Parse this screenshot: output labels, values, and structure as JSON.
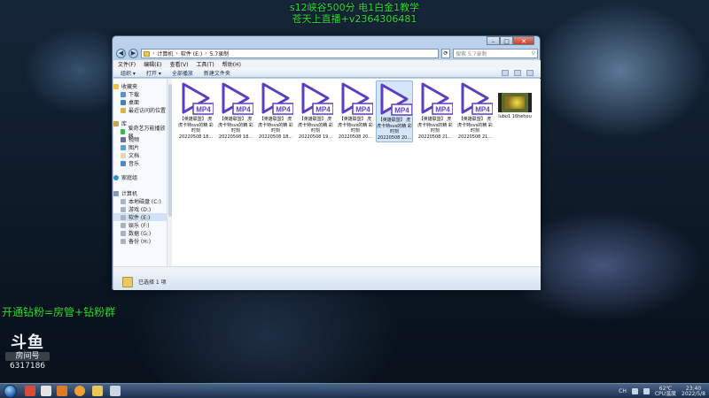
{
  "overlay": {
    "top_line1": "s12峡谷500分 电1白金1教学",
    "top_line2": "苍天上直播+v2364306481",
    "left_text": "开通钻粉=房管+钻粉群"
  },
  "douyu": {
    "logo": "斗鱼",
    "room_label": "房间号",
    "room_number": "6317186"
  },
  "window": {
    "controls": {
      "minimize": "–",
      "maximize": "□",
      "close": "✕"
    },
    "address": {
      "crumbs": [
        "计算机",
        "软件 (E:)",
        "5.7录制"
      ],
      "separator": "›"
    },
    "search_placeholder": "搜索 5.7录制",
    "search_icon": "magnifier-icon",
    "menu": [
      "文件(F)",
      "编辑(E)",
      "查看(V)",
      "工具(T)",
      "帮助(H)"
    ],
    "toolbar": [
      "组织 ▾",
      "打开 ▾",
      "全部播放",
      "新建文件夹"
    ],
    "nav": {
      "favorites_title": "收藏夹",
      "favorites": [
        "下载",
        "桌面",
        "最近访问的位置"
      ],
      "libraries_title": "库",
      "libraries": [
        "爱奇艺万能播放器",
        "视频",
        "图片",
        "文档",
        "音乐"
      ],
      "homegroup": "家庭组",
      "computer_title": "计算机",
      "drives": [
        "本地磁盘 (C:)",
        "游戏 (D:)",
        "软件 (E:)",
        "娱乐 (F:)",
        "数据 (G:)",
        "备份 (H:)"
      ]
    },
    "files": [
      {
        "badge": "MP4",
        "name": "【英雄联盟】 虎 虎卡特svs的精 彩时刻",
        "date": "20220508 18..."
      },
      {
        "badge": "MP4",
        "name": "【英雄联盟】 虎 虎卡特svs的精 彩时刻",
        "date": "20220508 18..."
      },
      {
        "badge": "MP4",
        "name": "【英雄联盟】 虎 虎卡特svs的精 彩时刻",
        "date": "20220508 18..."
      },
      {
        "badge": "MP4",
        "name": "【英雄联盟】 虎 虎卡特svs的精 彩时刻",
        "date": "20220508 19..."
      },
      {
        "badge": "MP4",
        "name": "【英雄联盟】 虎 虎卡特svs的精 彩时刻",
        "date": "20220508 20..."
      },
      {
        "badge": "MP4",
        "name": "【英雄联盟】 虎 虎卡特svs的精 彩时刻",
        "date": "20220508 20..."
      },
      {
        "badge": "MP4",
        "name": "【英雄联盟】 虎 虎卡特svs的精 彩时刻",
        "date": "20220508 21..."
      },
      {
        "badge": "MP4",
        "name": "【英雄联盟】 虎 虎卡特svs的精 彩时刻",
        "date": "20220508 21..."
      }
    ],
    "video_file": {
      "name": "lubo1 16hehou"
    },
    "status": "已选择 1 项"
  },
  "taskbar": {
    "lang": "CH",
    "cpu_temp": "62℃",
    "cpu_label": "CPU温度",
    "time": "23:40",
    "date": "2022/5/8"
  }
}
